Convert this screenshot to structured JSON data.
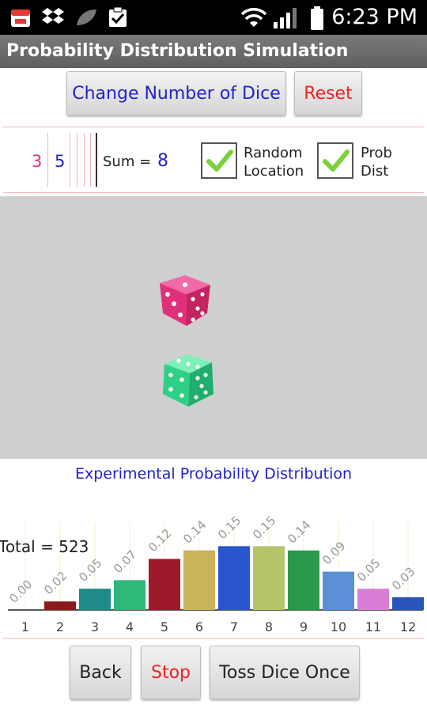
{
  "status_bar": {
    "time": "6:23 PM",
    "icons": [
      "calendar-icon",
      "dropbox-icon",
      "leaf-icon",
      "clipboard-check-icon",
      "wifi-icon",
      "signal-icon",
      "battery-icon"
    ]
  },
  "app": {
    "title": "Probability Distribution Simulation"
  },
  "top_buttons": {
    "change_dice": "Change Number of Dice",
    "reset": "Reset"
  },
  "dice_values": {
    "die1": "3",
    "die2": "5"
  },
  "sum": {
    "label": "Sum =",
    "value": "8"
  },
  "options": {
    "random_location": {
      "label_line1": "Random",
      "label_line2": "Location",
      "checked": true
    },
    "prob_dist": {
      "label_line1": "Prob",
      "label_line2": "Dist",
      "checked": true
    }
  },
  "colors": {
    "die1": "#e0307a",
    "die2": "#2ecf86",
    "blue_text": "#2222cc",
    "red_text": "#ee2222",
    "dice_area": "#cfcfcf"
  },
  "chart_data": {
    "type": "bar",
    "title": "Experimental Probability Distribution",
    "total_label": "Total = 523",
    "categories": [
      "1",
      "2",
      "3",
      "4",
      "5",
      "6",
      "7",
      "8",
      "9",
      "10",
      "11",
      "12"
    ],
    "values": [
      0.0,
      0.02,
      0.05,
      0.07,
      0.12,
      0.14,
      0.15,
      0.15,
      0.14,
      0.09,
      0.05,
      0.03
    ],
    "value_labels": [
      "0.00",
      "0.02",
      "0.05",
      "0.07",
      "0.12",
      "0.14",
      "0.15",
      "0.15",
      "0.14",
      "0.09",
      "0.05",
      "0.03"
    ],
    "bar_colors": [
      "#444444",
      "#8b1a1a",
      "#1f8a8a",
      "#2eb87a",
      "#9c1a2a",
      "#c9b45a",
      "#2a55cc",
      "#b7c36a",
      "#2a9a4a",
      "#5b8fd6",
      "#d97ed6",
      "#2a55bb"
    ],
    "ylim": [
      0,
      0.16
    ]
  },
  "bottom_buttons": {
    "back": "Back",
    "stop": "Stop",
    "toss": "Toss Dice Once"
  }
}
